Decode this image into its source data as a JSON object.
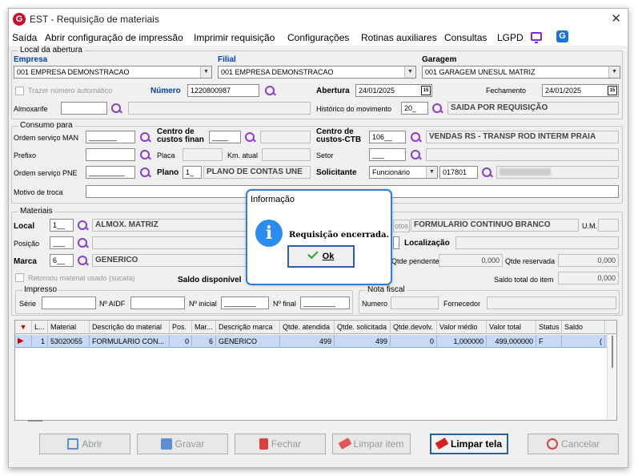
{
  "window": {
    "title": "EST - Requisição de materiais",
    "close": "✕",
    "logo": "G"
  },
  "menu": {
    "items": [
      "Saída",
      "Abrir configuração de impressão",
      "Imprimir requisição",
      "Configurações",
      "Rotinas auxiliares",
      "Consultas",
      "LGPD"
    ]
  },
  "local": {
    "title": "Local da abertura",
    "empresa_label": "Empresa",
    "empresa_value": "001 EMPRESA DEMONSTRACAO",
    "filial_label": "Filial",
    "filial_value": "001 EMPRESA DEMONSTRACAO",
    "garagem_label": "Garagem",
    "garagem_value": "001 GARAGEM UNESUL MATRIZ",
    "trazer_label": "Trazer número automático",
    "numero_label": "Número",
    "numero_value": "1220800987",
    "abertura_label": "Abertura",
    "abertura_value": "24/01/2025",
    "fechamento_label": "Fechamento",
    "fechamento_value": "24/01/2025",
    "almoxarife_label": "Almoxarife",
    "historico_label": "Histórico do movimento",
    "historico_code": "20_",
    "historico_desc": "SAIDA POR REQUISIÇÃO",
    "cal": "15"
  },
  "consumo": {
    "title": "Consumo para",
    "os_man_label": "Ordem serviço MAN",
    "os_man_value": "_______",
    "cc_fin_label": "Centro de custos finan",
    "cc_fin_value": "____",
    "cc_ctb_label": "Centro de custos-CTB",
    "cc_ctb_code": "106__",
    "cc_ctb_desc": "VENDAS RS - TRANSP ROD INTERM PRAIA",
    "prefixo_label": "Prefixo",
    "placa_label": "Placa",
    "km_label": "Km. atual",
    "setor_label": "Setor",
    "setor_value": "___",
    "os_pne_label": "Ordem serviço PNE",
    "os_pne_value": "_________",
    "plano_label": "Plano",
    "plano_code": "1_",
    "plano_desc": "PLANO DE CONTAS UNE",
    "solicitante_label": "Solicitante",
    "solicitante_type": "Funcionário",
    "solicitante_code": "017801",
    "motivo_label": "Motivo de troca"
  },
  "materiais": {
    "title": "Materiais",
    "local_label": "Local",
    "local_code": "1__",
    "local_desc": "ALMOX. MATRIZ",
    "material_desc": "FORMULARIO CONTINUO BRANCO",
    "fotos_label": "otos",
    "um_label": "U.M.",
    "posicao_label": "Posição",
    "posicao_value": "___",
    "localizacao_label": "Localização",
    "marca_label": "Marca",
    "marca_code": "6__",
    "marca_desc": "GENERICO",
    "qtde_pend_label": "Qtde pendente",
    "qtde_pend_value": "0,000",
    "qtde_res_label": "Qtde reservada",
    "qtde_res_value": "0,000",
    "retornou_label": "Retornou material usado (sucata)",
    "saldo_disp_label": "Saldo disponível",
    "saldo_total_label": "Saldo total do item",
    "saldo_total_value": "0,000"
  },
  "impresso": {
    "title": "Impresso",
    "serie_label": "Série",
    "aidf_label": "Nº AIDF",
    "inicial_label": "Nº inicial",
    "inicial_value": "________",
    "final_label": "Nº final",
    "final_value": "________"
  },
  "nota": {
    "title": "Nota fiscal",
    "numero_label": "Numero",
    "fornecedor_label": "Fornecedor"
  },
  "grid": {
    "columns": [
      "L...",
      "Material",
      "Descrição do material",
      "Pos.",
      "Mar...",
      "Descrição marca",
      "Qtde. atendida",
      "Qtde. solicitada",
      "Qtde.devolv.",
      "Valor médio",
      "Valor total",
      "Status",
      "Saldo"
    ],
    "rows": [
      [
        "1",
        "53020055",
        "FORMULARIO CON...",
        "0",
        "6",
        "GENERICO",
        "499",
        "499",
        "0",
        "1,000000",
        "499,000000",
        "F",
        "("
      ]
    ]
  },
  "buttons": {
    "abrir": "Abrir",
    "gravar": "Gravar",
    "fechar": "Fechar",
    "limpar_item": "Limpar item",
    "limpar_tela": "Limpar tela",
    "cancelar": "Cancelar"
  },
  "dialog": {
    "title": "Informação",
    "icon": "i",
    "message": "Requisição encerrada.",
    "ok": "Ok"
  },
  "colors": {
    "accent": "#2e7ddb",
    "search_icon": "#8b3ec9",
    "selected_row": "#c7d9f4",
    "label_blue": "#003fa8"
  }
}
